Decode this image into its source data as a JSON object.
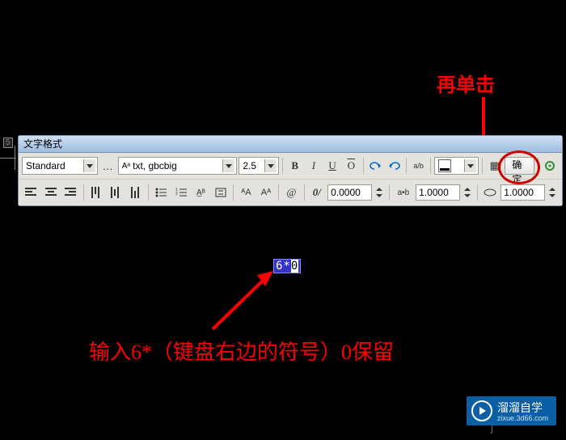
{
  "panel": {
    "title": "文字格式",
    "style_combo": "Standard",
    "font_combo": "txt, gbcbig",
    "size_combo": "2.5",
    "bold": "B",
    "italic": "I",
    "underline": "U",
    "overline": "O",
    "ok": "确定",
    "tracking": "0.0000",
    "width_factor": "1.0000",
    "oblique": "1.0000",
    "stack_a": "a",
    "stack_b": "b",
    "at": "@",
    "zero_slash": "0/",
    "aA1": "ᴬA",
    "aA2": "Aᴬ",
    "ruler_icon": "▦",
    "color_label": " "
  },
  "annotations": {
    "click_again": "再单击",
    "input_hint": "输入6*（键盘右边的符号）0保留",
    "textbox_value": "6*",
    "textbox_sel": "0"
  },
  "watermark": {
    "brand": "溜溜自学",
    "url": "zixue.3d66.com",
    "j": "j"
  }
}
